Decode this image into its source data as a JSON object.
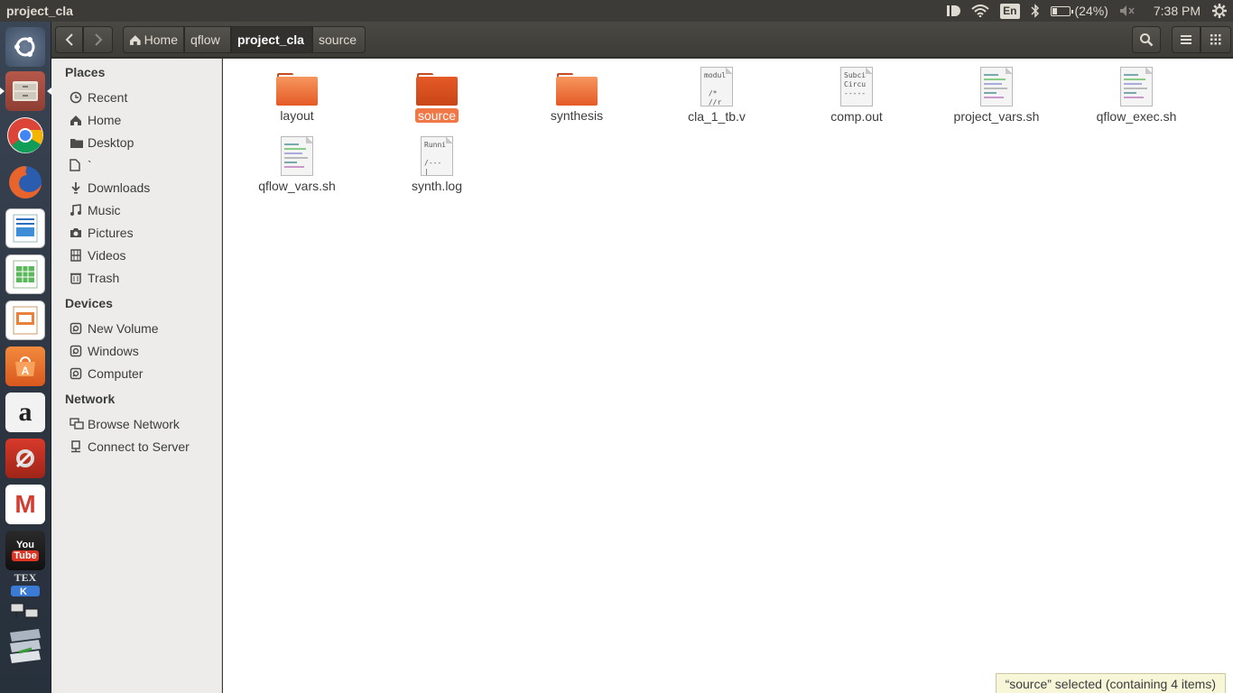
{
  "top_panel": {
    "window_title": "project_cla",
    "battery": "(24%)",
    "battery_level": 0.24,
    "language": "En",
    "clock": "7:38 PM"
  },
  "launcher": {
    "items": [
      {
        "name": "ubuntu-dash-icon"
      },
      {
        "name": "files-icon"
      },
      {
        "name": "chrome-icon"
      },
      {
        "name": "firefox-icon"
      },
      {
        "name": "writer-icon"
      },
      {
        "name": "calc-icon"
      },
      {
        "name": "impress-icon"
      },
      {
        "name": "software-center-icon"
      },
      {
        "name": "amazon-icon"
      },
      {
        "name": "system-settings-icon"
      },
      {
        "name": "gmail-icon"
      },
      {
        "name": "youtube-icon"
      }
    ],
    "youtube_label": "You",
    "youtube_label2": "Tube",
    "amazon_label": "a",
    "gmail_label": "M",
    "tex_label": "TEX"
  },
  "header": {
    "back_icon": "chevron-left-icon",
    "forward_icon": "chevron-right-icon",
    "breadcrumbs": [
      "Home",
      "qflow",
      "project_cla",
      "source"
    ],
    "active_crumb": "project_cla"
  },
  "sidebar": {
    "places_heading": "Places",
    "places": [
      {
        "label": "Recent",
        "icon": "clock-icon"
      },
      {
        "label": "Home",
        "icon": "home-icon"
      },
      {
        "label": "Desktop",
        "icon": "desktop-icon"
      },
      {
        "label": "`",
        "icon": "file-icon"
      },
      {
        "label": "Downloads",
        "icon": "download-icon"
      },
      {
        "label": "Music",
        "icon": "music-icon"
      },
      {
        "label": "Pictures",
        "icon": "camera-icon"
      },
      {
        "label": "Videos",
        "icon": "film-icon"
      },
      {
        "label": "Trash",
        "icon": "trash-icon"
      }
    ],
    "devices_heading": "Devices",
    "devices": [
      {
        "label": "New Volume",
        "icon": "drive-icon"
      },
      {
        "label": "Windows",
        "icon": "drive-icon"
      },
      {
        "label": "Computer",
        "icon": "drive-icon"
      }
    ],
    "network_heading": "Network",
    "network": [
      {
        "label": "Browse Network",
        "icon": "network-icon"
      },
      {
        "label": "Connect to Server",
        "icon": "server-icon"
      }
    ]
  },
  "files": [
    {
      "name": "layout",
      "type": "folder"
    },
    {
      "name": "source",
      "type": "folder",
      "selected": true
    },
    {
      "name": "synthesis",
      "type": "folder"
    },
    {
      "name": "cla_1_tb.v",
      "type": "text",
      "preview": "modul\n\n /*\n //r"
    },
    {
      "name": "comp.out",
      "type": "text",
      "preview": "Subci\nCircu\n-----"
    },
    {
      "name": "project_vars.sh",
      "type": "script"
    },
    {
      "name": "qflow_exec.sh",
      "type": "script"
    },
    {
      "name": "qflow_vars.sh",
      "type": "script"
    },
    {
      "name": "synth.log",
      "type": "text",
      "preview": "Runni\n\n/---\n|"
    }
  ],
  "status_text": "“source” selected  (containing 4 items)"
}
